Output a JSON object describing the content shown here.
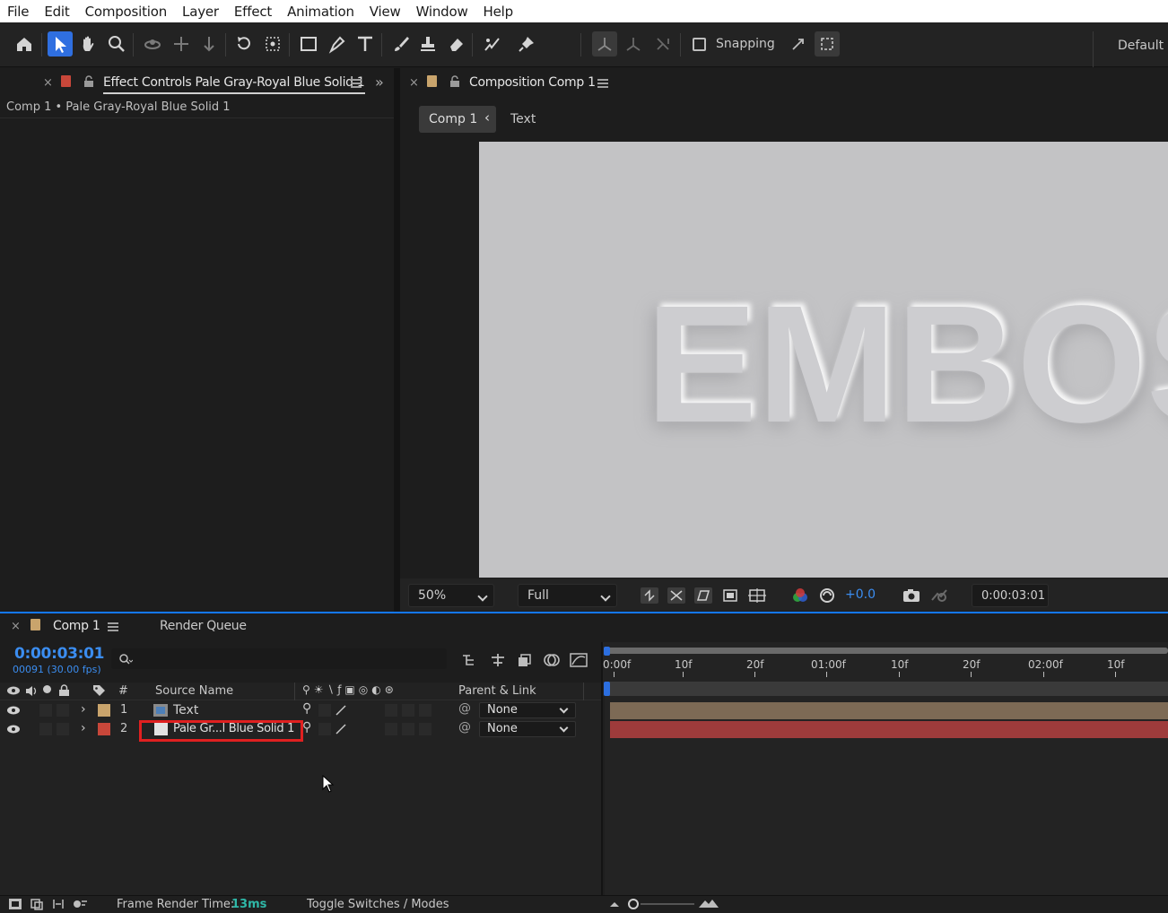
{
  "menu": [
    "File",
    "Edit",
    "Composition",
    "Layer",
    "Effect",
    "Animation",
    "View",
    "Window",
    "Help"
  ],
  "toolbar": {
    "snapping_label": "Snapping",
    "workspace_label": "Default"
  },
  "effect_controls": {
    "tab_title": "Effect Controls Pale Gray-Royal Blue Solid 1",
    "breadcrumb": "Comp 1 • Pale Gray-Royal Blue Solid 1",
    "chip_color": "#c8473a"
  },
  "composition": {
    "tab_title": "Composition Comp 1",
    "chip_color": "#c9a46c",
    "flow_active": "Comp 1",
    "flow_next": "Text",
    "canvas_text": "EMBOSS",
    "zoom": "50%",
    "resolution": "Full",
    "exposure": "+0.0",
    "timecode": "0:00:03:01"
  },
  "timeline": {
    "tab_title": "Comp 1",
    "render_queue": "Render Queue",
    "timecode": "0:00:03:01",
    "fps_line": "00091 (30.00 fps)",
    "columns": {
      "hash": "#",
      "source_name": "Source Name",
      "parent_link": "Parent & Link"
    },
    "layers": [
      {
        "num": "1",
        "name": "Text",
        "label_color": "#c9a46c",
        "parent": "None"
      },
      {
        "num": "2",
        "name": "Pale Gr...l Blue Solid 1",
        "label_color": "#c8473a",
        "parent": "None"
      }
    ],
    "ruler_ticks": [
      "0:00f",
      "10f",
      "20f",
      "01:00f",
      "10f",
      "20f",
      "02:00f",
      "10f"
    ]
  },
  "status": {
    "frame_render_label": "Frame Render Time:",
    "frame_render_value": "13ms",
    "toggle_label": "Toggle Switches / Modes"
  }
}
